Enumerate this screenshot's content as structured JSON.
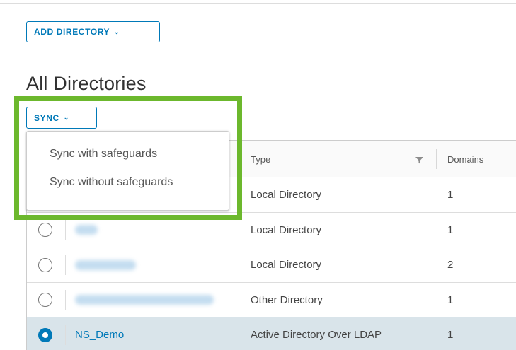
{
  "toolbar": {
    "add_directory_label": "ADD DIRECTORY",
    "add_directory_icon": "chevron-down-icon"
  },
  "page": {
    "title": "All Directories"
  },
  "sync": {
    "label": "SYNC",
    "menu_items": [
      "Sync with safeguards",
      "Sync without safeguards"
    ]
  },
  "table": {
    "columns": {
      "type": "Type",
      "domains": "Domains"
    },
    "rows": [
      {
        "name": "",
        "type": "Local Directory",
        "domains": "1",
        "selected": false
      },
      {
        "name": "",
        "type": "Local Directory",
        "domains": "1",
        "selected": false
      },
      {
        "name": "",
        "type": "Local Directory",
        "domains": "2",
        "selected": false
      },
      {
        "name": "",
        "type": "Other Directory",
        "domains": "1",
        "selected": false
      },
      {
        "name": "NS_Demo",
        "type": "Active Directory Over LDAP",
        "domains": "1",
        "selected": true
      }
    ]
  },
  "colors": {
    "accent": "#0079b8",
    "highlight": "#6cb82d",
    "selected_row": "#d9e4ea"
  }
}
